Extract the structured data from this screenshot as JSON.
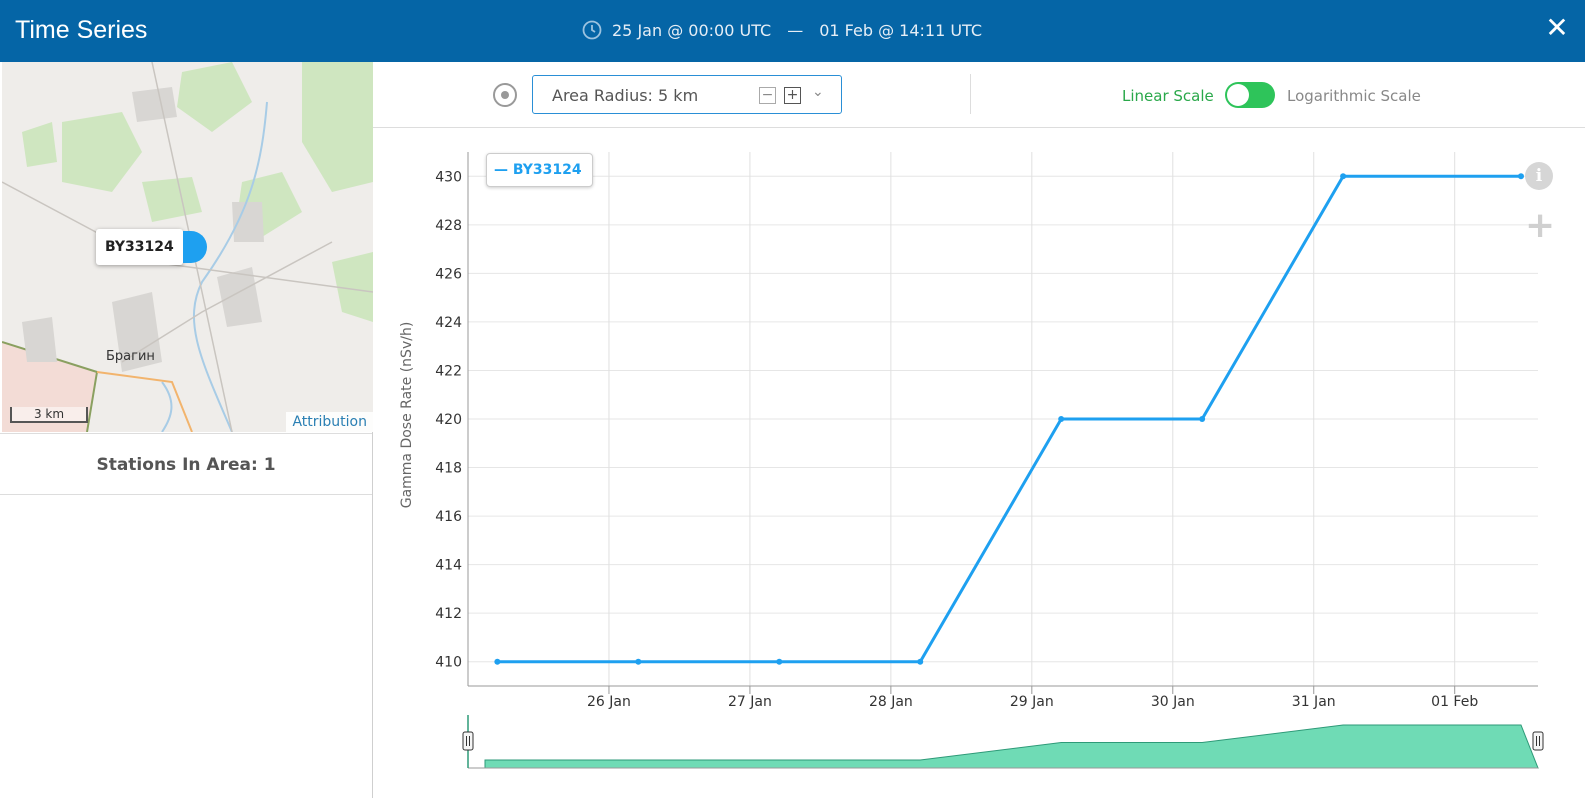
{
  "header": {
    "title": "Time Series",
    "time_range_start": "25 Jan @ 00:00 UTC",
    "time_range_separator": "—",
    "time_range_end": "01 Feb @ 14:11 UTC",
    "clock_icon": "clock-icon",
    "close_icon": "close-icon"
  },
  "map": {
    "station_label": "BY33124",
    "town_label": "Брагин",
    "scale_label": "3 km",
    "attribution": "Attribution"
  },
  "stations": {
    "count_text": "Stations In Area: 1"
  },
  "toolbar": {
    "radius_label": "Area Radius: 5 km",
    "linear_label": "Linear Scale",
    "log_label": "Logarithmic Scale",
    "scale_toggle_on": "linear",
    "accent_color": "#2ec45a"
  },
  "chart_data": {
    "type": "line",
    "ylabel": "Gamma Dose Rate (nSv/h)",
    "xlabel": "",
    "ylim": [
      409,
      431
    ],
    "y_ticks": [
      410,
      412,
      414,
      416,
      418,
      420,
      422,
      424,
      426,
      428,
      430
    ],
    "x_ticks": [
      "26 Jan",
      "27 Jan",
      "28 Jan",
      "29 Jan",
      "30 Jan",
      "31 Jan",
      "01 Feb"
    ],
    "grid": true,
    "legend_position": "top-left",
    "series": [
      {
        "name": "BY33124",
        "color": "#1ea0f0",
        "x": [
          "25 Jan 05:00",
          "26 Jan 05:00",
          "27 Jan 05:00",
          "28 Jan 05:00",
          "29 Jan 05:00",
          "30 Jan 05:00",
          "31 Jan 05:00",
          "01 Feb 05:00"
        ],
        "y": [
          410,
          410,
          410,
          410,
          420,
          420,
          430,
          430
        ]
      }
    ],
    "navigator_color": "#6fdbb5"
  }
}
